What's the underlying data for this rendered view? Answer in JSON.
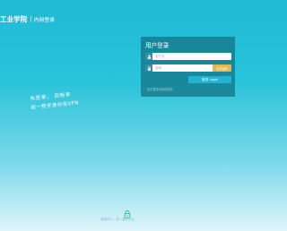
{
  "header": {
    "title": "工业学院",
    "separator": "|",
    "subtitle": "内网登录"
  },
  "slogan": {
    "line1": "先登录，  后畅享",
    "line2": "统一数字身份免VPN"
  },
  "login": {
    "title": "用户登录",
    "username_placeholder": "用户名",
    "password_placeholder": "密码",
    "forgot_label": "忘记密码",
    "submit_label": "登录 Login",
    "note": "· 首次登录请修改密码"
  },
  "footer": {
    "text": "数据中心 · 统一身份认证",
    "icon": "lock-icon"
  },
  "colors": {
    "accent": "#22b3d2",
    "warning": "#e5b84c",
    "panel": "#147082"
  }
}
